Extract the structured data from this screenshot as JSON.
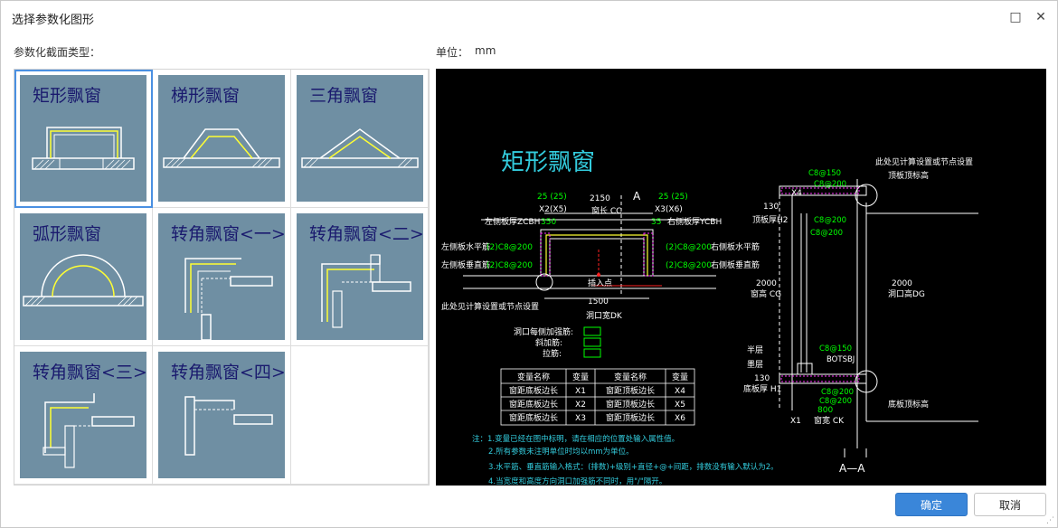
{
  "window": {
    "title": "选择参数化图形",
    "maximize_icon": "□",
    "close_icon": "✕"
  },
  "left_label": "参数化截面类型：",
  "unit_label": "单位：",
  "unit_value": "mm",
  "shapes": [
    {
      "label": "矩形飘窗",
      "icon": "rect-bay-window"
    },
    {
      "label": "梯形飘窗",
      "icon": "trapezoid-bay-window"
    },
    {
      "label": "三角飘窗",
      "icon": "triangle-bay-window"
    },
    {
      "label": "弧形飘窗",
      "icon": "arc-bay-window"
    },
    {
      "label": "转角飘窗<一>",
      "icon": "corner-bay-window-1"
    },
    {
      "label": "转角飘窗<二>",
      "icon": "corner-bay-window-2"
    },
    {
      "label": "转角飘窗<三>",
      "icon": "corner-bay-window-3"
    },
    {
      "label": "转角飘窗<四>",
      "icon": "corner-bay-window-4"
    }
  ],
  "preview": {
    "title": "矩形飘窗",
    "dims": {
      "d25a": "25 (25)",
      "d2150": "2150",
      "d25b": "25 (25)",
      "x2x5": "X2(X5)",
      "x3x6": "X3(X6)",
      "cc": "窗长 CC",
      "a": "A",
      "d350": "350",
      "d35": "35",
      "d1500": "1500",
      "dk": "洞口宽DK",
      "d130": "130",
      "h2": "顶板厚H2",
      "d2000a": "2000",
      "cg": "窗高 CG",
      "d2000b": "2000",
      "dg": "洞口高DG",
      "d130b": "130",
      "h1": "底板厚 H1",
      "d800": "800",
      "ck": "窗宽 CK",
      "x1": "X1",
      "x4": "X4",
      "aa": "A—A"
    },
    "annotations": {
      "left_zcbh": "左侧板厚ZCBH",
      "right_ycbh": "右侧板厚YCBH",
      "left_horiz": "左侧板水平筋",
      "left_horiz_val": "(2)C8@200",
      "left_vert": "左侧板垂直筋",
      "left_vert_val": "(2)C8@200",
      "right_horiz": "右侧板水平筋",
      "right_horiz_val": "(2)C8@200",
      "right_vert": "右侧板垂直筋",
      "right_vert_val": "(2)C8@200",
      "insert_pt": "插入点",
      "see_calc": "此处见计算设置或节点设置",
      "see_calc2": "此处见计算设置或节点设置",
      "top_elev": "顶板顶标高",
      "bottom_elev": "底板顶标高",
      "c8150a": "C8@150",
      "c8200a": "C8@200",
      "c8200b": "C8@200",
      "c8200c": "C8@200",
      "c8150b": "C8@150",
      "botsbj": "BOTSBJ",
      "c8200d": "C8@200",
      "c8200e": "C8@200",
      "hole_each": "洞口每侧加强筋:",
      "diag": "斜加筋:",
      "tie": "拉筋:",
      "half_a": "半层",
      "half_b": "墨层"
    },
    "table": {
      "headers": [
        "变量名称",
        "变量",
        "变量名称",
        "变量"
      ],
      "rows": [
        [
          "窗距底板边长",
          "X1",
          "窗距顶板边长",
          "X4"
        ],
        [
          "窗距底板边长",
          "X2",
          "窗距顶板边长",
          "X5"
        ],
        [
          "窗距底板边长",
          "X3",
          "窗距顶板边长",
          "X6"
        ]
      ]
    },
    "notes": [
      "注：1.变量已经在图中标明，请在相应的位置处输入属性值。",
      "2.所有参数未注明单位时均以mm为单位。",
      "3.水平筋、垂直筋输入格式：(排数)+级别+直径+@+间距，排数没有输入默认为2。",
      "4.当宽度和高度方向洞口加强筋不同时，用\"/\"隔开。"
    ]
  },
  "buttons": {
    "ok": "确定",
    "cancel": "取消"
  }
}
